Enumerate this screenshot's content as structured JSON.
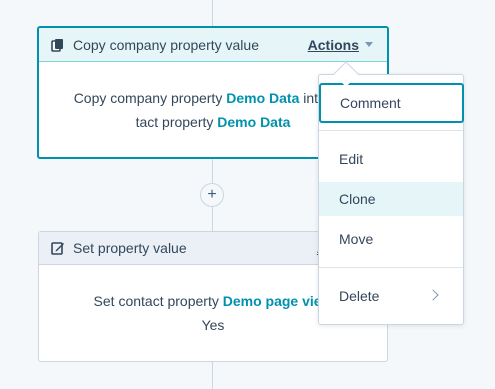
{
  "workflow": {
    "add_button_label": "+",
    "cards": [
      {
        "title": "Copy company property value",
        "actions_label": "Actions",
        "body_prefix": "Copy company property ",
        "body_source": "Demo Data",
        "body_middle": " into con",
        "body_line2_prefix": "tact property ",
        "body_target": "Demo Data"
      },
      {
        "title": "Set property value",
        "actions_label": "A",
        "body_prefix": "Set contact property ",
        "body_property": "Demo page view",
        "body_line2": "Yes"
      }
    ]
  },
  "actions_menu": {
    "items": [
      {
        "label": "Comment"
      },
      {
        "label": "Edit"
      },
      {
        "label": "Clone"
      },
      {
        "label": "Move"
      },
      {
        "label": "Delete"
      }
    ]
  },
  "colors": {
    "accent": "#0091ae",
    "text": "#33475b",
    "border": "#cbd6e2",
    "header_bg": "#e5f5f8",
    "hover_bg": "#e5f5f8"
  }
}
